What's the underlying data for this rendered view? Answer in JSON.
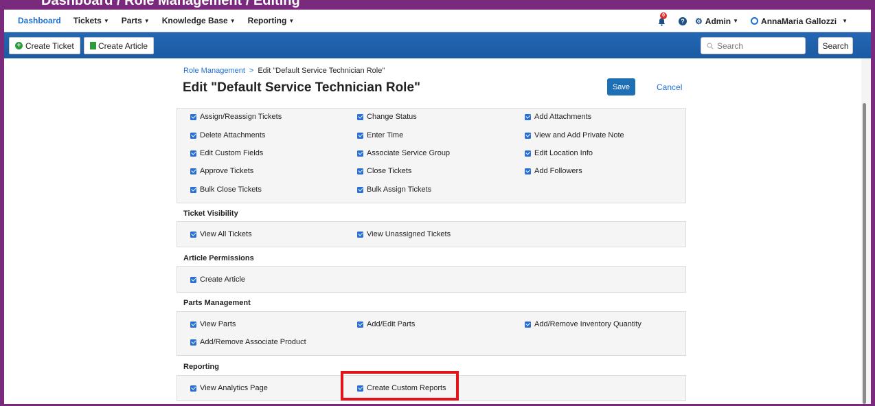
{
  "banner": {
    "text": "Dashboard / Role Management / Editing"
  },
  "nav": {
    "items": [
      "Dashboard",
      "Tickets",
      "Parts",
      "Knowledge Base",
      "Reporting"
    ],
    "notification_count": "0",
    "help": "?",
    "admin_label": "Admin",
    "user_name": "AnnaMaria Gallozzi"
  },
  "toolbar": {
    "create_ticket": "Create Ticket",
    "create_article": "Create Article",
    "search_placeholder": "Search",
    "search_button": "Search"
  },
  "breadcrumb": {
    "parent": "Role Management",
    "separator": ">",
    "current": "Edit \"Default Service Technician Role\""
  },
  "page": {
    "title": "Edit \"Default Service Technician Role\"",
    "save": "Save",
    "cancel": "Cancel"
  },
  "sections": {
    "ticket_permissions": {
      "items": [
        "Assign/Reassign Tickets",
        "Change Status",
        "Add Attachments",
        "Delete Attachments",
        "Enter Time",
        "View and Add Private Note",
        "Edit Custom Fields",
        "Associate Service Group",
        "Edit Location Info",
        "Approve Tickets",
        "Close Tickets",
        "Add Followers",
        "Bulk Close Tickets",
        "Bulk Assign Tickets"
      ]
    },
    "ticket_visibility": {
      "title": "Ticket Visibility",
      "items": [
        "View All Tickets",
        "View Unassigned Tickets"
      ]
    },
    "article_permissions": {
      "title": "Article Permissions",
      "items": [
        "Create Article"
      ]
    },
    "parts_management": {
      "title": "Parts Management",
      "items": [
        "View Parts",
        "Add/Edit Parts",
        "Add/Remove Inventory Quantity",
        "Add/Remove Associate Product"
      ]
    },
    "reporting": {
      "title": "Reporting",
      "items": [
        "View Analytics Page",
        "Create Custom Reports"
      ]
    }
  },
  "colors": {
    "accent": "#1f6fd1",
    "toolbar": "#1b5aa3",
    "frame": "#7a2a7c",
    "highlight": "#e3131b"
  }
}
